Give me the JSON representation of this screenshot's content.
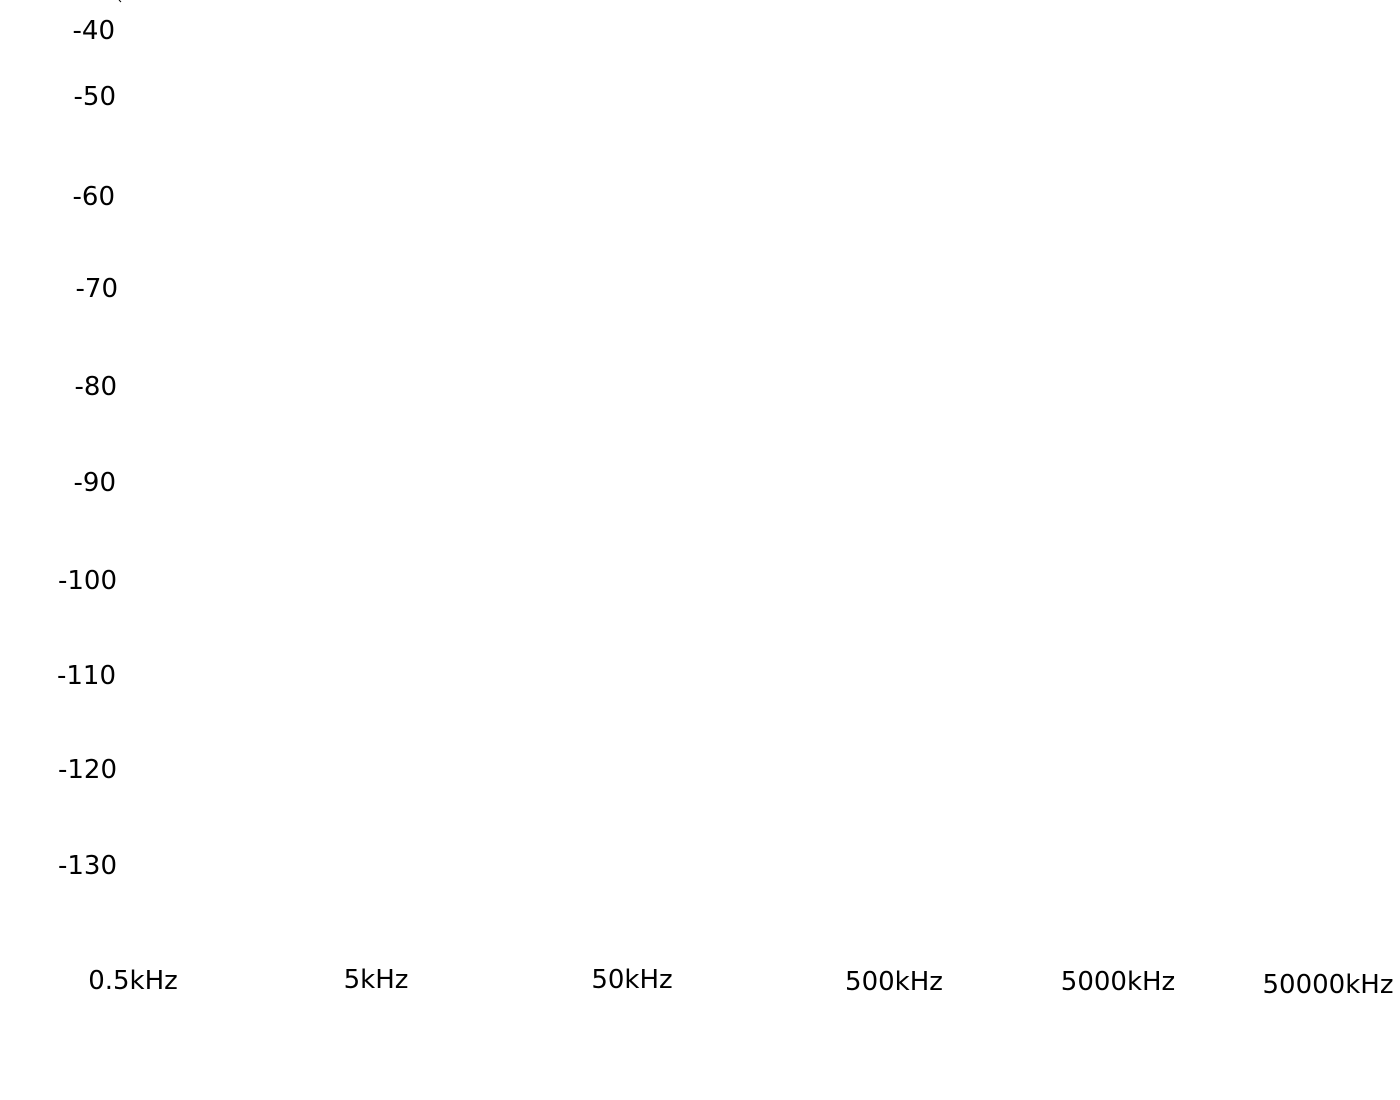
{
  "chart_data": {
    "type": "line",
    "title": "",
    "xlabel": "",
    "ylabel": "",
    "x_scale": "log",
    "x_tick_labels": [
      "0.5kHz",
      "5kHz",
      "50kHz",
      "500kHz",
      "5000kHz",
      "50000kHz"
    ],
    "y_tick_labels": [
      "-40",
      "-50",
      "-60",
      "-70",
      "-80",
      "-90",
      "-100",
      "-110",
      "-120",
      "-130"
    ],
    "ylim": [
      -130,
      -40
    ],
    "grid": false,
    "legend": "none",
    "series": [],
    "text_color": "#000000",
    "background": "#ffffff"
  }
}
